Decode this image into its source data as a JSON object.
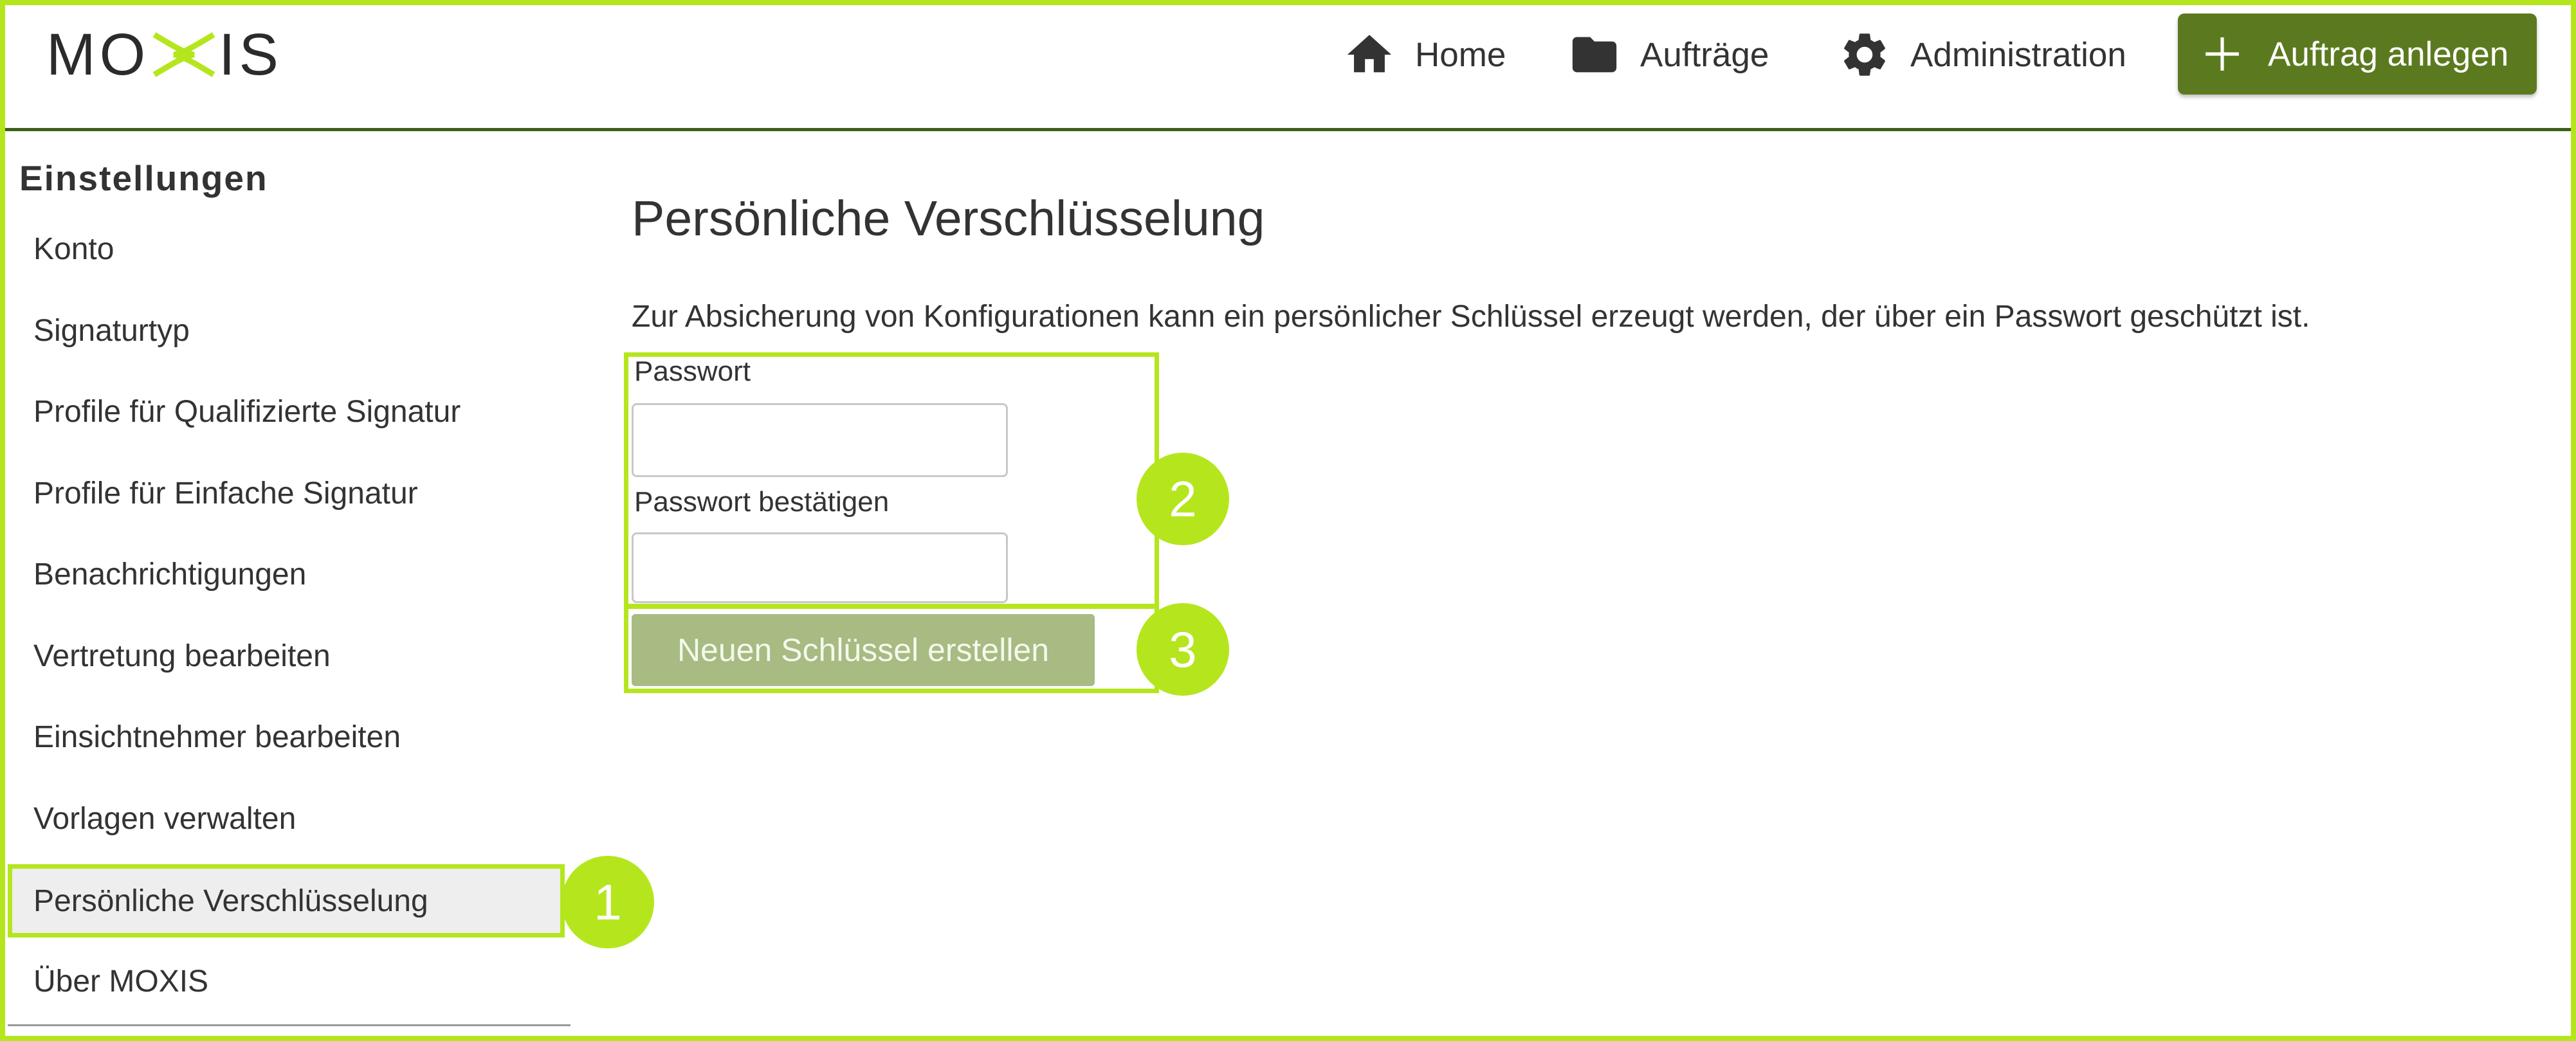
{
  "header": {
    "logo_text": "MOXIS",
    "nav": [
      {
        "label": "Home",
        "icon": "home-icon"
      },
      {
        "label": "Aufträge",
        "icon": "folder-icon"
      },
      {
        "label": "Administration",
        "icon": "gear-icon"
      }
    ],
    "create_button": {
      "label": "Auftrag anlegen",
      "icon": "plus-icon"
    }
  },
  "sidebar": {
    "heading": "Einstellungen",
    "items": [
      {
        "label": "Konto"
      },
      {
        "label": "Signaturtyp"
      },
      {
        "label": "Profile für Qualifizierte Signatur"
      },
      {
        "label": "Profile für Einfache Signatur"
      },
      {
        "label": "Benachrichtigungen"
      },
      {
        "label": "Vertretung bearbeiten"
      },
      {
        "label": "Einsichtnehmer bearbeiten"
      },
      {
        "label": "Vorlagen verwalten"
      },
      {
        "label": "Persönliche Verschlüsselung",
        "active": true
      },
      {
        "label": "Über MOXIS"
      }
    ]
  },
  "main": {
    "title": "Persönliche Verschlüsselung",
    "intro": "Zur Absicherung von Konfigurationen kann ein persönlicher Schlüssel erzeugt werden, der über ein Passwort geschützt ist.",
    "password_label": "Passwort",
    "password_value": "",
    "confirm_label": "Passwort bestätigen",
    "confirm_value": "",
    "create_key_button": "Neuen Schlüssel erstellen"
  },
  "callouts": [
    "1",
    "2",
    "3"
  ],
  "colors": {
    "accent": "#b5e61d",
    "primary_button": "#5b7a1f",
    "disabled_button": "#a7bb82",
    "header_rule": "#3e5f1a",
    "active_item_bg": "#eeeeee"
  }
}
